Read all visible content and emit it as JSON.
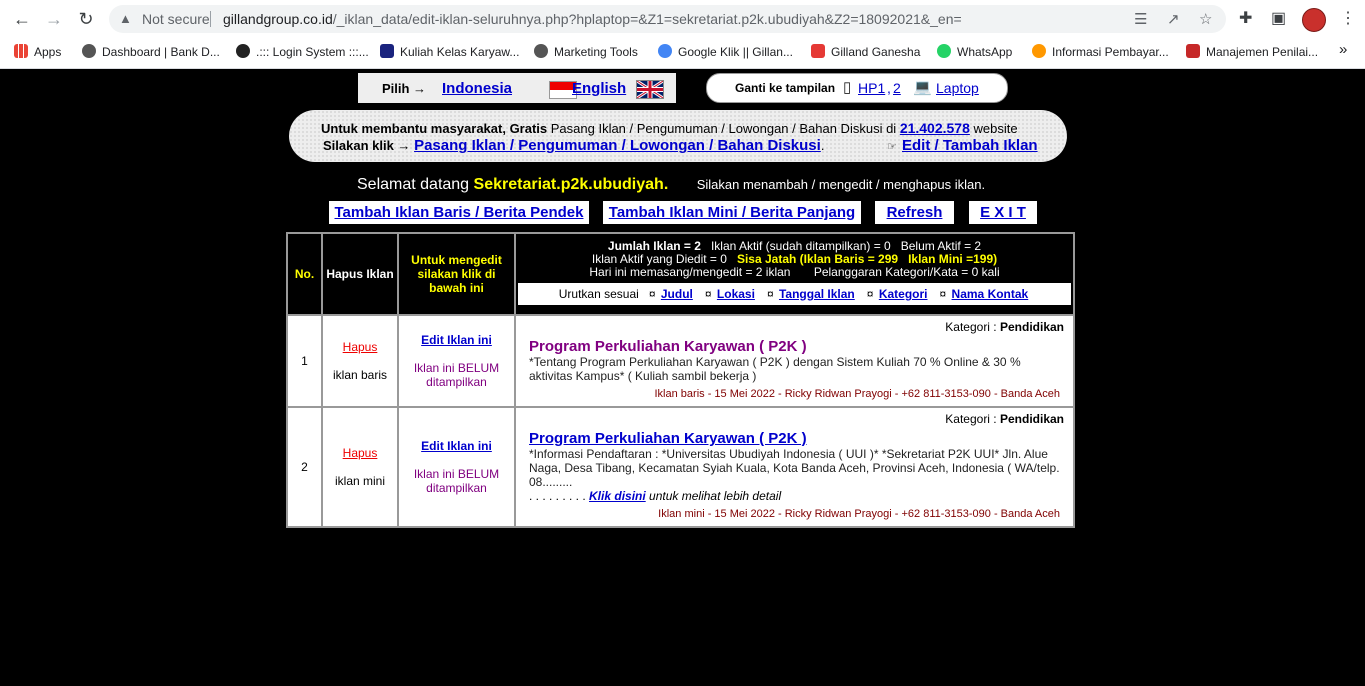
{
  "browser": {
    "not_secure": "Not secure",
    "url_domain": "gillandgroup.co.id",
    "url_path": "/_iklan_data/edit-iklan-seluruhnya.php?hplaptop=&Z1=sekretariat.p2k.ubudiyah&Z2=18092021&_en="
  },
  "bookmarks": [
    {
      "label": "Apps",
      "color": "#ea4335"
    },
    {
      "label": "Dashboard | Bank D...",
      "color": "#555555"
    },
    {
      "label": ".::: Login System :::...",
      "color": "#222222"
    },
    {
      "label": "Kuliah Kelas Karyaw...",
      "color": "#1a237e"
    },
    {
      "label": "Marketing Tools",
      "color": "#555555"
    },
    {
      "label": "Google Klik || Gillan...",
      "color": "#4285f4"
    },
    {
      "label": "Gilland Ganesha",
      "color": "#e53935"
    },
    {
      "label": "WhatsApp",
      "color": "#25d366"
    },
    {
      "label": "Informasi Pembayar...",
      "color": "#ff9800"
    },
    {
      "label": "Manajemen Penilai...",
      "color": "#c62828"
    }
  ],
  "lang": {
    "pilih": "Pilih →",
    "indonesia": "Indonesia",
    "english": "English"
  },
  "view": {
    "label": "Ganti ke tampilan",
    "hp1": "HP1",
    "hp2": "2",
    "laptop": "Laptop"
  },
  "promo": {
    "line1_bold": "Untuk membantu masyarakat, Gratis",
    "line1_text": " Pasang Iklan / Pengumuman / Lowongan / Bahan Diskusi di ",
    "count": "21.402.578",
    "line1_end": " website",
    "line2_bold": "Silakan klik →",
    "line2_link": "Pasang Iklan / Pengumuman / Lowongan / Bahan Diskusi",
    "edit_link": "Edit / Tambah Iklan"
  },
  "welcome": {
    "text": "Selamat datang",
    "user": "Sekretariat.p2k.ubudiyah.",
    "hint": "Silakan menambah / mengedit / menghapus iklan."
  },
  "buttons": {
    "add_row": "Tambah Iklan Baris / Berita Pendek",
    "add_mini": "Tambah Iklan Mini / Berita Panjang",
    "refresh": "Refresh",
    "exit": "E X I T"
  },
  "table": {
    "h_no": "No.",
    "h_delete": "Hapus Iklan",
    "h_edit": "Untuk mengedit silakan klik di bawah ini",
    "stats": {
      "s1a": "Jumlah Iklan = 2",
      "s1b": "Iklan Aktif (sudah ditampilkan) = 0",
      "s1c": "Belum Aktif = 2",
      "s2a": "Iklan Aktif yang Diedit = 0",
      "s2b": "Sisa Jatah (Iklan Baris = 299",
      "s2c": "Iklan Mini =199)",
      "s3a": "Hari ini memasang/mengedit = 2 iklan",
      "s3b": "Pelanggaran Kategori/Kata = 0 kali"
    },
    "sort": {
      "label": "Urutkan sesuai",
      "judul": "Judul",
      "lokasi": "Lokasi",
      "tanggal": "Tanggal Iklan",
      "kategori": "Kategori",
      "nama": "Nama Kontak"
    },
    "rows": [
      {
        "no": "1",
        "hapus": "Hapus",
        "type": "iklan baris",
        "edit": "Edit Iklan ini",
        "status": "Iklan ini BELUM ditampilkan",
        "kategori_label": "Kategori : ",
        "kategori": "Pendidikan",
        "title": "Program Perkuliahan Karyawan ( P2K )",
        "desc": "*Tentang Program Perkuliahan Karyawan ( P2K ) dengan Sistem Kuliah 70 % Online & 30 % aktivitas Kampus* ( Kuliah sambil bekerja )",
        "footer": "Iklan baris - 15 Mei 2022 - Ricky Ridwan Prayogi - +62 811-3153-090 - Banda Aceh"
      },
      {
        "no": "2",
        "hapus": "Hapus",
        "type": "iklan mini",
        "edit": "Edit Iklan ini",
        "status": "Iklan ini BELUM ditampilkan",
        "kategori_label": "Kategori : ",
        "kategori": "Pendidikan",
        "title": "Program Perkuliahan Karyawan ( P2K )",
        "desc": "*Informasi Pendaftaran : *Universitas Ubudiyah Indonesia ( UUI )* *Sekretariat P2K UUI* Jln. Alue Naga, Desa Tibang, Kecamatan Syiah Kuala, Kota Banda Aceh, Provinsi Aceh, Indonesia ( WA/telp. 08.........",
        "more_dots": ". . . . . . . . . ",
        "more_link": "Klik disini",
        "more_text": " untuk melihat lebih detail",
        "footer": "Iklan mini - 15 Mei 2022 - Ricky Ridwan Prayogi - +62 811-3153-090 - Banda Aceh"
      }
    ]
  }
}
